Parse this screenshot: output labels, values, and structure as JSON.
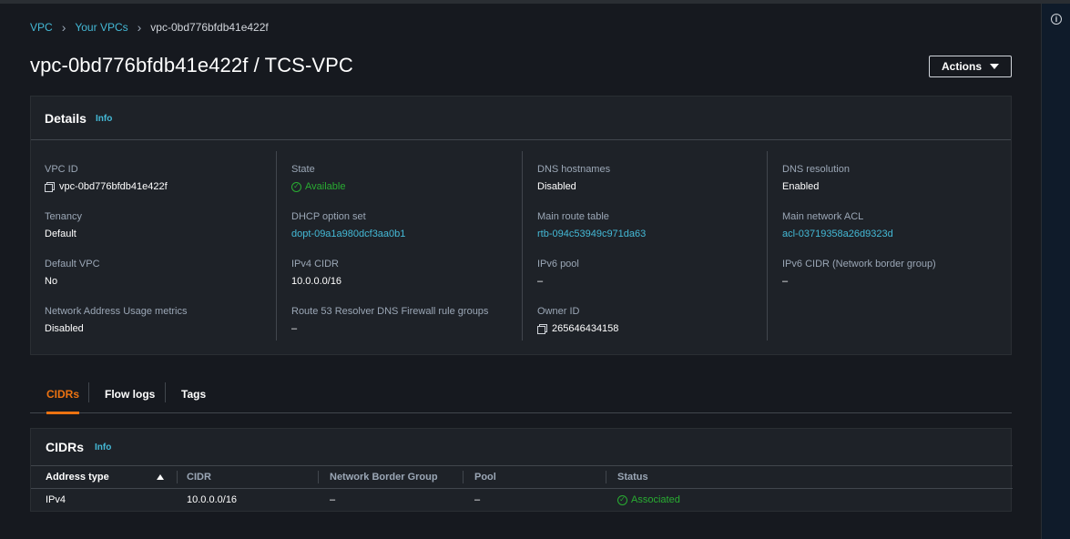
{
  "breadcrumb": {
    "items": [
      "VPC",
      "Your VPCs"
    ],
    "current": "vpc-0bd776bfdb41e422f"
  },
  "page": {
    "title": "vpc-0bd776bfdb41e422f / TCS-VPC",
    "actions_label": "Actions"
  },
  "details": {
    "title": "Details",
    "info_label": "Info",
    "columns": [
      [
        {
          "label": "VPC ID",
          "value": "vpc-0bd776bfdb41e422f"
        },
        {
          "label": "Tenancy",
          "value": "Default"
        },
        {
          "label": "Default VPC",
          "value": "No"
        },
        {
          "label": "Network Address Usage metrics",
          "value": "Disabled"
        }
      ],
      [
        {
          "label": "State",
          "value": "Available"
        },
        {
          "label": "DHCP option set",
          "value": "dopt-09a1a980dcf3aa0b1"
        },
        {
          "label": "IPv4 CIDR",
          "value": "10.0.0.0/16"
        },
        {
          "label": "Route 53 Resolver DNS Firewall rule groups",
          "value": "–"
        }
      ],
      [
        {
          "label": "DNS hostnames",
          "value": "Disabled"
        },
        {
          "label": "Main route table",
          "value": "rtb-094c53949c971da63"
        },
        {
          "label": "IPv6 pool",
          "value": "–"
        },
        {
          "label": "Owner ID",
          "value": "265646434158"
        }
      ],
      [
        {
          "label": "DNS resolution",
          "value": "Enabled"
        },
        {
          "label": "Main network ACL",
          "value": "acl-03719358a26d9323d"
        },
        {
          "label": "IPv6 CIDR (Network border group)",
          "value": "–"
        }
      ]
    ]
  },
  "tabs": [
    "CIDRs",
    "Flow logs",
    "Tags"
  ],
  "cidrs": {
    "title": "CIDRs",
    "info_label": "Info",
    "headers": [
      "Address type",
      "CIDR",
      "Network Border Group",
      "Pool",
      "Status"
    ],
    "rows": [
      [
        "IPv4",
        "10.0.0.0/16",
        "–",
        "–",
        "Associated"
      ]
    ]
  },
  "colors": {
    "link": "#44b9d6",
    "success": "#29ad32",
    "active_tab": "#ec7211",
    "panel_bg": "#1e2228",
    "page_bg": "#16191f"
  }
}
